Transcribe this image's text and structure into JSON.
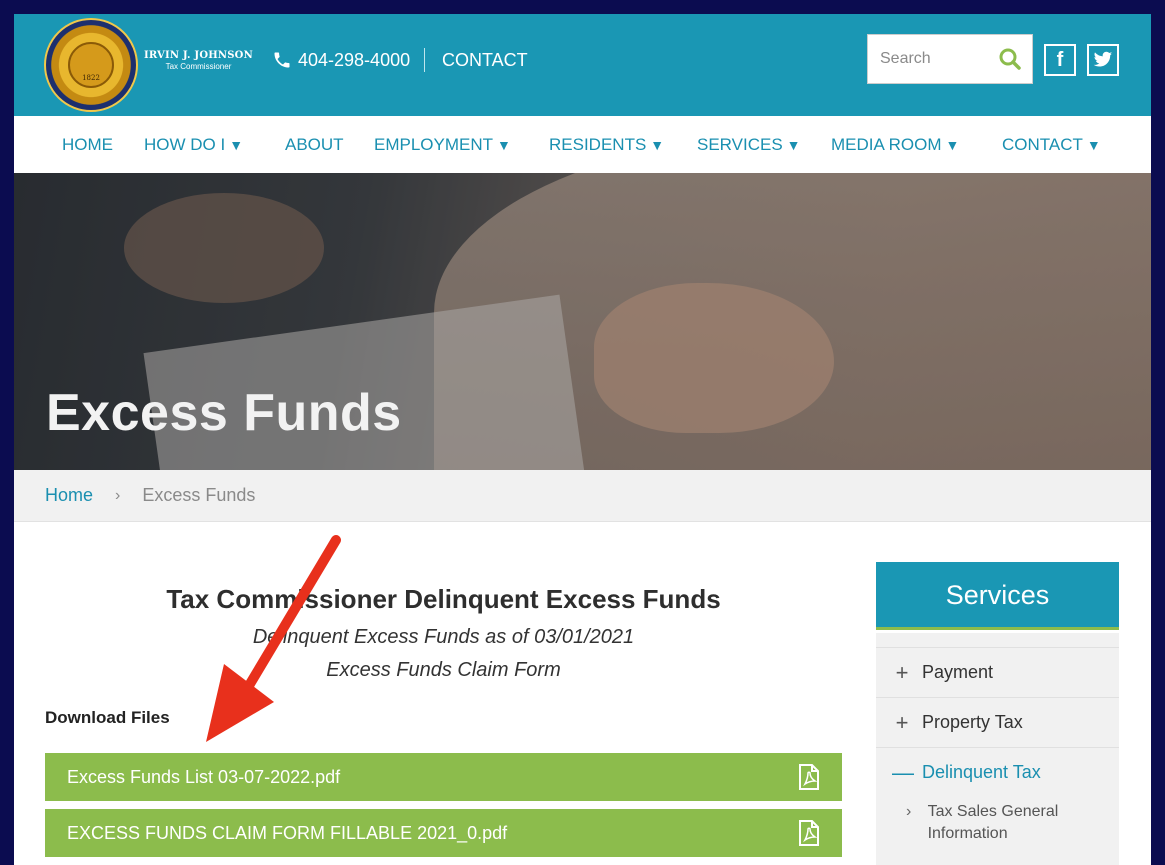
{
  "header": {
    "brand_name": "IRVIN J. JOHNSON",
    "brand_title": "Tax Commissioner",
    "seal_text": "DEKALB·COUNTY·GEORGIA · TAX COMMISSIONER",
    "seal_year": "1822",
    "phone": "404-298-4000",
    "contact": "CONTACT",
    "search_placeholder": "Search",
    "facebook": "f"
  },
  "nav": {
    "items": [
      {
        "label": "HOME",
        "has_caret": false
      },
      {
        "label": "HOW DO I",
        "has_caret": true
      },
      {
        "label": "ABOUT",
        "has_caret": false
      },
      {
        "label": "EMPLOYMENT",
        "has_caret": true
      },
      {
        "label": "RESIDENTS",
        "has_caret": true
      },
      {
        "label": "SERVICES",
        "has_caret": true
      },
      {
        "label": "MEDIA ROOM",
        "has_caret": true
      },
      {
        "label": "CONTACT",
        "has_caret": true
      }
    ],
    "caret": "▼"
  },
  "hero": {
    "title": "Excess Funds"
  },
  "breadcrumb": {
    "home": "Home",
    "separator": "›",
    "current": "Excess Funds"
  },
  "main": {
    "title": "Tax Commissioner Delinquent Excess Funds",
    "subtitle1": "Delinquent Excess Funds as of 03/01/2021",
    "subtitle2": "Excess Funds Claim Form",
    "download_label": "Download Files",
    "files": [
      {
        "name": "Excess Funds List 03-07-2022.pdf"
      },
      {
        "name": "EXCESS FUNDS CLAIM FORM FILLABLE 2021_0.pdf"
      }
    ]
  },
  "sidebar": {
    "heading": "Services",
    "items": [
      {
        "label": "Payment",
        "symbol": "+"
      },
      {
        "label": "Property Tax",
        "symbol": "+"
      },
      {
        "label": "Delinquent Tax",
        "symbol": "—"
      }
    ],
    "subitem": {
      "label": "Tax Sales General Information",
      "symbol": "›"
    }
  },
  "colors": {
    "brand_teal": "#1a97b4",
    "link_blue": "#1a8fb0",
    "file_green": "#8cbc4c",
    "annotation_red": "#e8301c",
    "frame_navy": "#0b0c50"
  }
}
